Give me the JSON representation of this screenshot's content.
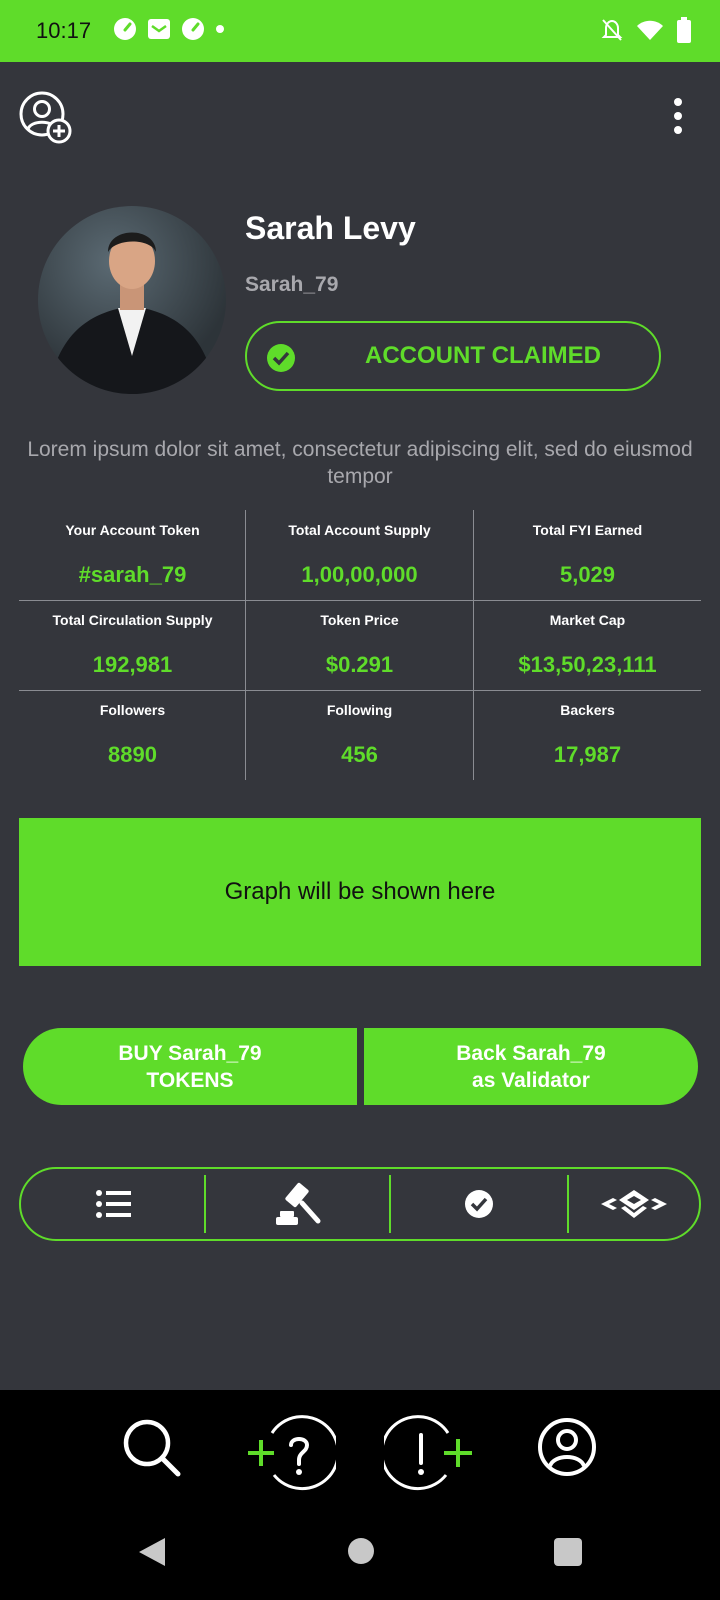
{
  "status_bar": {
    "time": "10:17",
    "icons_left": [
      "speedometer-icon",
      "mail-icon",
      "speedometer-icon",
      "dot-icon"
    ],
    "icons_right": [
      "bell-off-icon",
      "wifi-icon",
      "battery-icon"
    ]
  },
  "app_bar": {
    "icons": [
      "add-user-icon",
      "more-vertical-icon"
    ]
  },
  "profile": {
    "name": "Sarah Levy",
    "handle": "Sarah_79",
    "claimed_label": "ACCOUNT CLAIMED",
    "bio": "Lorem ipsum dolor sit amet, consectetur adipiscing elit, sed do eiusmod tempor"
  },
  "stats": [
    {
      "label": "Your Account Token",
      "value": "#sarah_79"
    },
    {
      "label": "Total Account Supply",
      "value": "1,00,00,000"
    },
    {
      "label": "Total FYI Earned",
      "value": "5,029"
    },
    {
      "label": "Total Circulation Supply",
      "value": "192,981"
    },
    {
      "label": "Token Price",
      "value": "$0.291"
    },
    {
      "label": "Market Cap",
      "value": "$13,50,23,111"
    },
    {
      "label": "Followers",
      "value": "8890"
    },
    {
      "label": "Following",
      "value": "456"
    },
    {
      "label": "Backers",
      "value": "17,987"
    }
  ],
  "graph_placeholder": "Graph will be shown here",
  "actions": {
    "buy_line1": "BUY Sarah_79",
    "buy_line2": "TOKENS",
    "back_line1": "Back Sarah_79",
    "back_line2": "as Validator"
  },
  "tabs": [
    "list-icon",
    "gavel-icon",
    "check-circle-icon",
    "layers-icon"
  ],
  "bottom_nav": [
    "search-icon",
    "ask-question-icon",
    "add-alert-icon",
    "profile-icon"
  ],
  "system_nav": [
    "back-icon",
    "home-icon",
    "recents-icon"
  ],
  "colors": {
    "accent": "#5fdc2a",
    "background": "#34363c",
    "muted_text": "#a8a8ad"
  }
}
